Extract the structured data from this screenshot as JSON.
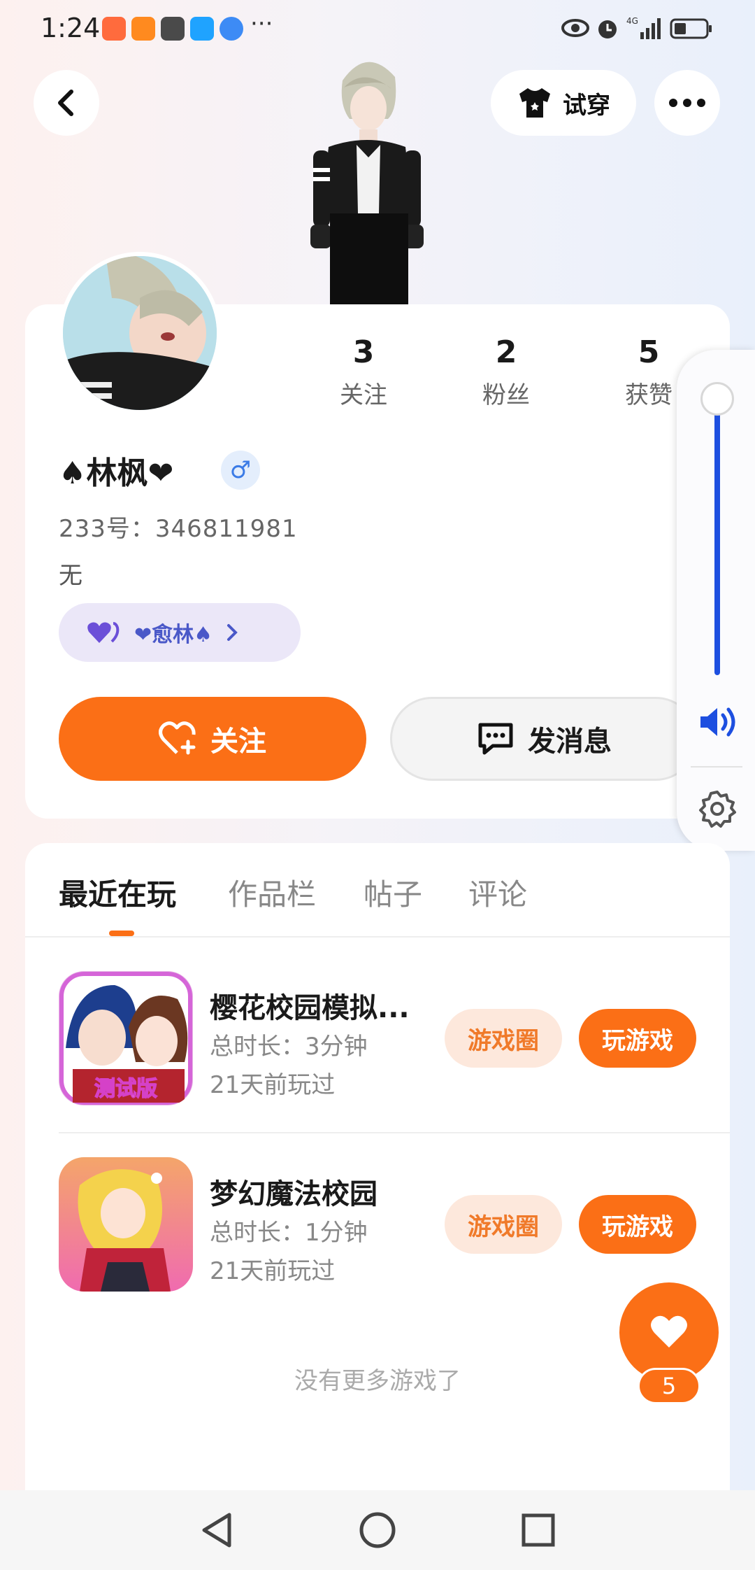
{
  "status_bar": {
    "time": "1:24",
    "dots": "···",
    "icons": [
      "eye-icon",
      "alarm-icon",
      "signal-4g-icon",
      "battery-icon"
    ]
  },
  "header": {
    "try_on_label": "试穿",
    "icons": [
      "back-arrow-icon",
      "tshirt-icon",
      "more-icon"
    ]
  },
  "profile": {
    "stats": [
      {
        "value": "3",
        "label": "关注"
      },
      {
        "value": "2",
        "label": "粉丝"
      },
      {
        "value": "5",
        "label": "获赞"
      }
    ],
    "name": "♠林枫❤",
    "gender_symbol": "♂",
    "uid": "233号：346811981",
    "bio": "无",
    "relation_label": "❤愈林♠",
    "follow_label": "关注",
    "message_label": "发消息"
  },
  "tabs": [
    {
      "label": "最近在玩",
      "active": true
    },
    {
      "label": "作品栏",
      "active": false
    },
    {
      "label": "帖子",
      "active": false
    },
    {
      "label": "评论",
      "active": false
    }
  ],
  "games": [
    {
      "title": "樱花校园模拟...",
      "duration": "总时长：3分钟",
      "last_played": "21天前玩过",
      "icon_badge": "测试版",
      "circle_label": "游戏圈",
      "play_label": "玩游戏"
    },
    {
      "title": "梦幻魔法校园",
      "duration": "总时长：1分钟",
      "last_played": "21天前玩过",
      "circle_label": "游戏圈",
      "play_label": "玩游戏"
    }
  ],
  "no_more_text": "没有更多游戏了",
  "like_count": "5",
  "volume": {
    "level": 1.0
  },
  "colors": {
    "accent": "#fb6f16",
    "accent_light": "#fde8dc",
    "volume_blue": "#1d4fe0",
    "relation_bg": "#ebe7f8"
  }
}
